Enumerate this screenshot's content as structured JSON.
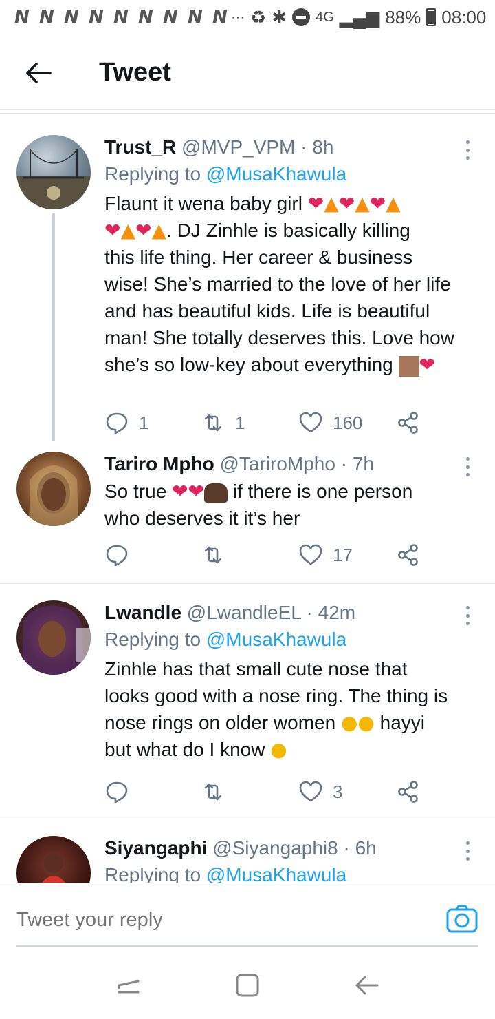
{
  "status_bar": {
    "notification_icons": [
      "N",
      "N",
      "N",
      "N",
      "N",
      "N",
      "N",
      "N",
      "N"
    ],
    "overflow": "···",
    "network": "4G",
    "battery": "88%",
    "time": "08:00"
  },
  "header": {
    "title": "Tweet"
  },
  "tweets": [
    {
      "name": "Trust_R",
      "handle": "@MVP_VPM",
      "time": "· 8h",
      "replying_prefix": "Replying to",
      "replying_to": "@MusaKhawula",
      "text_lines": [
        "Flaunt it wena baby girl",
        ". DJ Zinhle is basically killing",
        "this life thing. Her career & business",
        "wise! She’s married to the love of her life",
        "and has beautiful kids. Life is beautiful",
        "man! She totally deserves this. Love how",
        "she’s so low-key about everything"
      ],
      "replies": "1",
      "retweets": "1",
      "likes": "160",
      "avatar_colors": [
        "#556b7a",
        "#d9c7a0"
      ]
    },
    {
      "name": "Tariro Mpho",
      "handle": "@TariroMpho",
      "time": "· 7h",
      "text_lines": [
        "So true",
        "if there is one person",
        "who deserves it it’s her"
      ],
      "replies": "",
      "retweets": "",
      "likes": "17",
      "avatar_colors": [
        "#6b4a32",
        "#e7c38a"
      ]
    },
    {
      "name": "Lwandle",
      "handle": "@LwandleEL",
      "time": "· 42m",
      "replying_prefix": "Replying to",
      "replying_to": "@MusaKhawula",
      "text_lines": [
        "Zinhle has that small cute nose that",
        "looks good with a nose ring. The thing is",
        "nose rings on older women",
        "hayyi",
        "but what do I know"
      ],
      "replies": "",
      "retweets": "",
      "likes": "3",
      "avatar_colors": [
        "#3a1f4a",
        "#9b59b6"
      ]
    },
    {
      "name": "Siyangaphi",
      "handle": "@Siyangaphi8",
      "time": "· 6h",
      "replying_prefix": "Replying to",
      "replying_to": "@MusaKhawula",
      "avatar_colors": [
        "#3b1510",
        "#d9342b"
      ]
    }
  ],
  "reply_bar": {
    "placeholder": "Tweet your reply"
  },
  "colors": {
    "accent": "#1da1f2",
    "heart": "#e0245e",
    "muted": "#657786",
    "divider": "#e1e8ed"
  },
  "icons": {
    "back": "arrow-left-icon",
    "more": "more-vertical-icon",
    "reply": "reply-bubble-icon",
    "retweet": "retweet-icon",
    "like": "heart-outline-icon",
    "share": "share-icon",
    "camera": "camera-icon"
  }
}
